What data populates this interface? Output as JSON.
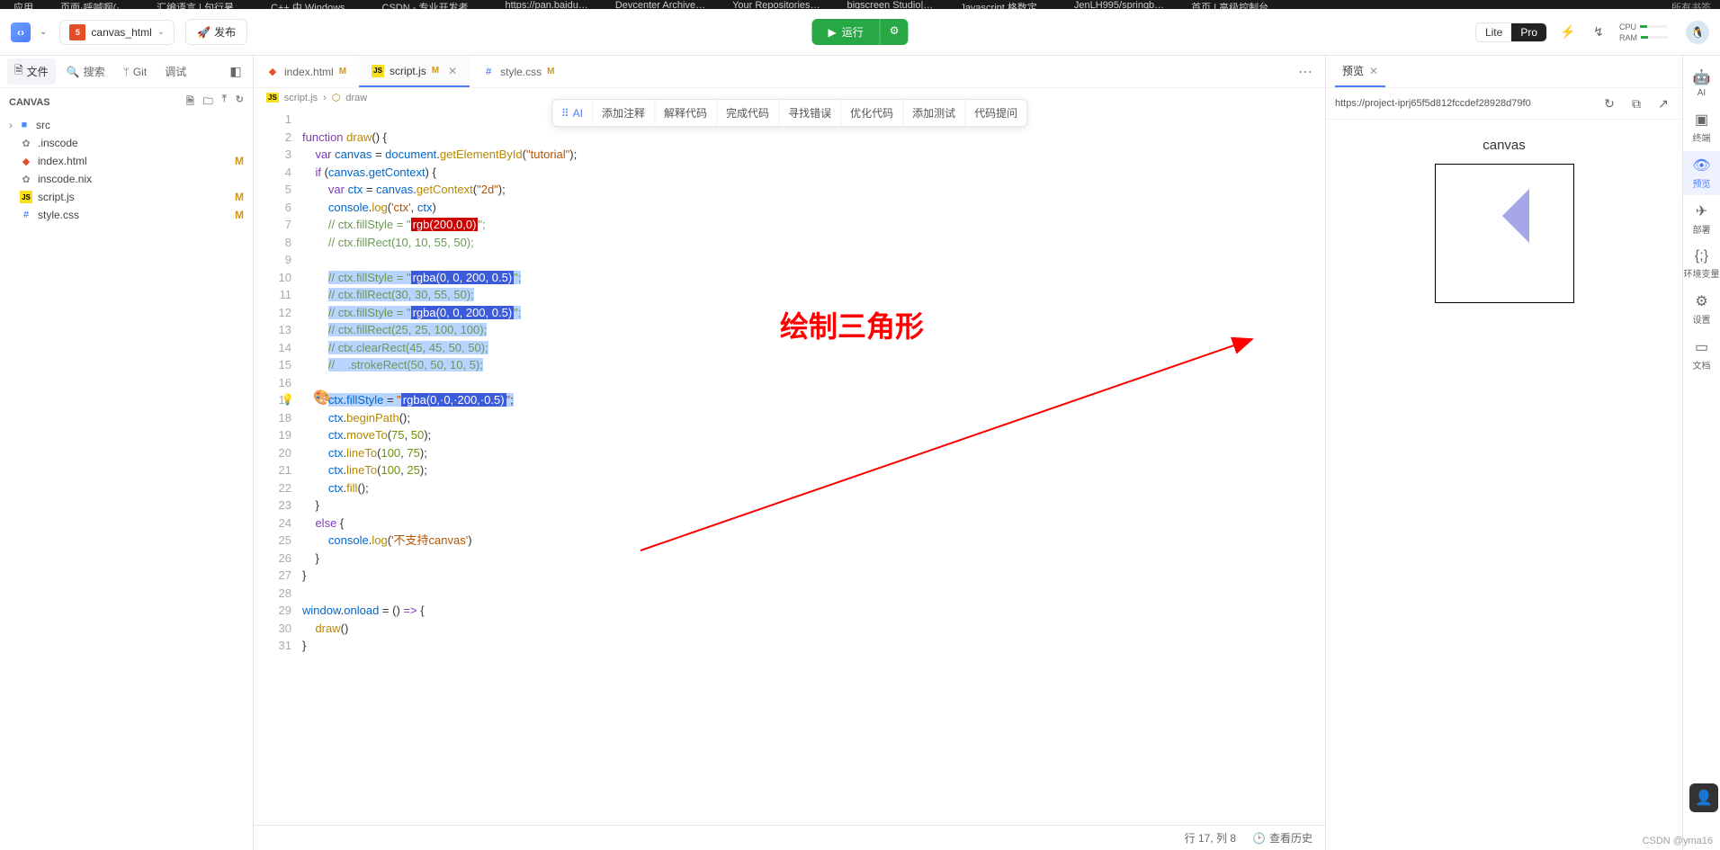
{
  "bookmarks": [
    "应用",
    "页面·呼喊啊(·…",
    "汇编语言 | 句行暑…",
    "C++ 中 Windows…",
    "CSDN - 专业开发者…",
    "https://pan.baidu…",
    "Devcenter Archive…",
    "Your Repositories…",
    "bigscreen Studio|…",
    "Javascript 格数定…",
    "JenLH995/springb…",
    "首页 | 高级控制台"
  ],
  "bookmarks_right": "所有书签",
  "header": {
    "project": "canvas_html",
    "publish": "发布",
    "run": "运行",
    "lite": "Lite",
    "pro": "Pro",
    "cpu": "CPU",
    "ram": "RAM"
  },
  "sidebar": {
    "tabs": {
      "files": "文件",
      "search": "搜索",
      "git": "Git",
      "debug": "调试"
    },
    "section": "CANVAS",
    "tree": [
      {
        "name": "src",
        "kind": "folder",
        "badge": ""
      },
      {
        "name": ".inscode",
        "kind": "gear",
        "badge": ""
      },
      {
        "name": "index.html",
        "kind": "h5",
        "badge": "M"
      },
      {
        "name": "inscode.nix",
        "kind": "gear",
        "badge": ""
      },
      {
        "name": "script.js",
        "kind": "js",
        "badge": "M"
      },
      {
        "name": "style.css",
        "kind": "css",
        "badge": "M"
      }
    ]
  },
  "editorTabs": [
    {
      "name": "index.html",
      "icon": "h5",
      "m": "M",
      "active": false
    },
    {
      "name": "script.js",
      "icon": "js",
      "m": "M",
      "active": true
    },
    {
      "name": "style.css",
      "icon": "css",
      "m": "M",
      "active": false
    }
  ],
  "breadcrumb": {
    "file": "script.js",
    "sym": "draw"
  },
  "aiToolbar": [
    "添加注释",
    "解释代码",
    "完成代码",
    "寻找错误",
    "优化代码",
    "添加测试",
    "代码提问"
  ],
  "aiPrimary": "AI",
  "code": {
    "lines": 31
  },
  "status": {
    "pos": "行 17, 列 8",
    "history": "查看历史"
  },
  "preview": {
    "tab": "预览",
    "url": "https://project-iprj65f5d812fccdef28928d79f0",
    "title": "canvas"
  },
  "rail": [
    {
      "ico": "🤖",
      "label": "AI"
    },
    {
      "ico": "▣",
      "label": "终端"
    },
    {
      "ico": "👁",
      "label": "预览",
      "active": true
    },
    {
      "ico": "✈",
      "label": "部署"
    },
    {
      "ico": "{;}",
      "label": "环境变量"
    },
    {
      "ico": "⚙",
      "label": "设置"
    },
    {
      "ico": "▭",
      "label": "文档"
    }
  ],
  "annotation": "绘制三角形",
  "watermark": "CSDN @yma16"
}
